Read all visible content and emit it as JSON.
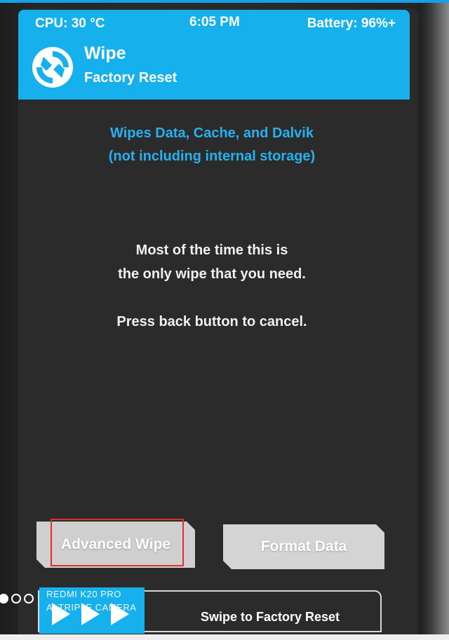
{
  "status_bar": {
    "cpu": "CPU: 30 °C",
    "time": "6:05 PM",
    "battery": "Battery: 96%+"
  },
  "header": {
    "logo_icon": "twrp-logo-icon",
    "title": "Wipe",
    "subtitle": "Factory Reset"
  },
  "description": {
    "line1": "Wipes Data, Cache, and Dalvik",
    "line2": "(not including internal storage)"
  },
  "info": {
    "line1": "Most of the time this is",
    "line2": "the only wipe that you need.",
    "line3": "Press back button to cancel."
  },
  "buttons": {
    "advanced_wipe": "Advanced Wipe",
    "format_data": "Format Data"
  },
  "swipe": {
    "label": "Swipe to Factory Reset",
    "handle_icon": "triple-arrow-icon"
  },
  "watermark": {
    "line1": "REDMI K20 PRO",
    "line2": "AI TRIPLE CAMERA"
  },
  "colors": {
    "accent": "#16b0ec",
    "description_text": "#27b1ef",
    "highlight": "#e0302c"
  }
}
